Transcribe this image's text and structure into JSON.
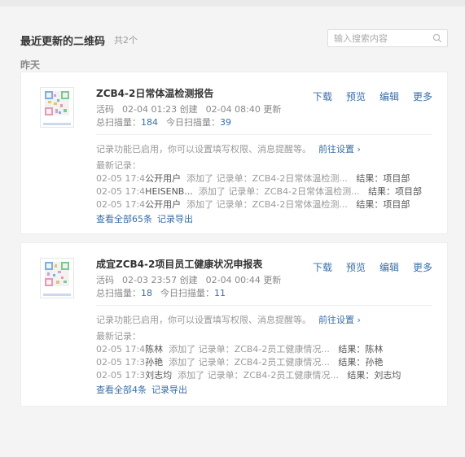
{
  "header": {
    "title": "最近更新的二维码",
    "count": "共2个",
    "search_placeholder": "输入搜索内容"
  },
  "group_label": "昨天",
  "cards": [
    {
      "title": "ZCB4-2日常体温检测报告",
      "status": "活码",
      "created": "02-04 01:23 创建",
      "updated": "02-04 08:40 更新",
      "total_scans_label": "总扫描量：",
      "total_scans": "184",
      "today_scans_label": "今日扫描量：",
      "today_scans": "39",
      "actions": [
        "下载",
        "预览",
        "编辑",
        "更多"
      ],
      "notice": "记录功能已启用，你可以设置填写权限、消息提醒等。",
      "notice_link": "前往设置 ›",
      "records_label": "最新记录：",
      "records": [
        {
          "time": "02-05 17:4",
          "user": "公开用户",
          "action": "添加了 记录单：ZCB4-2日常体温检测...",
          "result": "结果：项目部"
        },
        {
          "time": "02-05 17:4",
          "user": "HEISENB...",
          "action": "添加了 记录单：ZCB4-2日常体温检测...",
          "result": "结果：项目部"
        },
        {
          "time": "02-05 17:4",
          "user": "公开用户",
          "action": "添加了 记录单：ZCB4-2日常体温检测...",
          "result": "结果：项目部"
        }
      ],
      "view_all": "查看全部65条",
      "export": "记录导出"
    },
    {
      "title": "成宜ZCB4-2项目员工健康状况申报表",
      "status": "活码",
      "created": "02-03 23:57 创建",
      "updated": "02-04 00:44 更新",
      "total_scans_label": "总扫描量：",
      "total_scans": "18",
      "today_scans_label": "今日扫描量：",
      "today_scans": "11",
      "actions": [
        "下载",
        "预览",
        "编辑",
        "更多"
      ],
      "notice": "记录功能已启用，你可以设置填写权限、消息提醒等。",
      "notice_link": "前往设置 ›",
      "records_label": "最新记录：",
      "records": [
        {
          "time": "02-05 17:4",
          "user": "陈林",
          "action": "添加了 记录单：ZCB4-2员工健康情况...",
          "result": "结果：陈林"
        },
        {
          "time": "02-05 17:3",
          "user": "孙艳",
          "action": "添加了 记录单：ZCB4-2员工健康情况...",
          "result": "结果：孙艳"
        },
        {
          "time": "02-05 17:3",
          "user": "刘志均",
          "action": "添加了 记录单：ZCB4-2员工健康情况...",
          "result": "结果：刘志均"
        }
      ],
      "view_all": "查看全部4条",
      "export": "记录导出"
    }
  ]
}
